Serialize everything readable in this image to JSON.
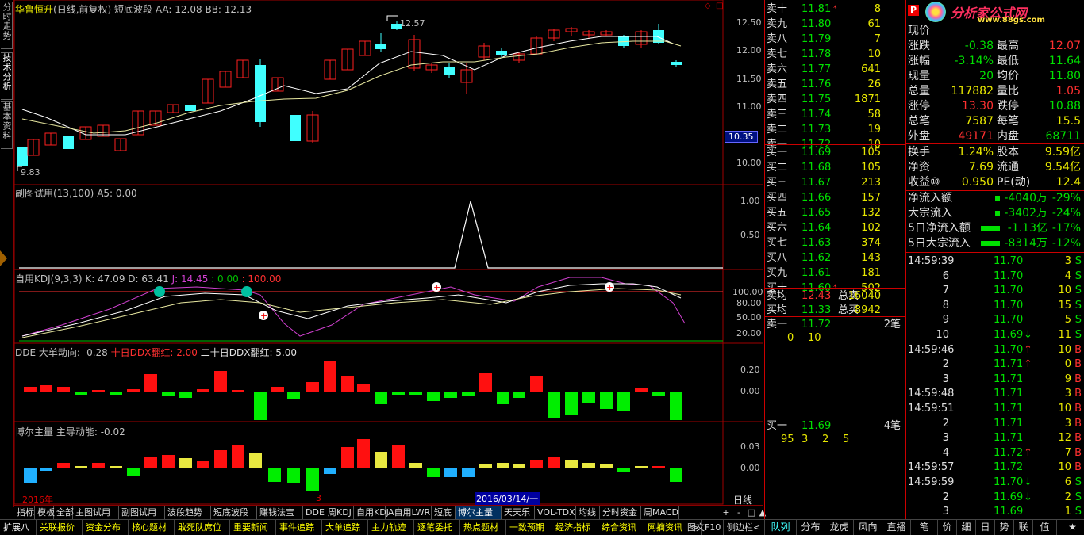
{
  "left_tabs": [
    "分时走势",
    "技术分析",
    "基本资料"
  ],
  "chart": {
    "stock_name": "华鲁恒升",
    "period_info": "(日线,前复权)",
    "indicator_name": "短底波段",
    "aa": "AA: 12.08",
    "bb": "BB: 12.13",
    "high_marker": "12.57",
    "low_marker": "9.83",
    "current_price_tag": "10.35",
    "y_ticks": [
      "12.50",
      "12.00",
      "11.50",
      "11.00",
      "10.50",
      "10.00"
    ],
    "sub1_title": "副图试用(13,100)",
    "sub1_a5": "A5: 0.00",
    "sub1_ticks": [
      "1.00",
      "0.50"
    ],
    "kdj_title": "自用KDJ(9,3,3)",
    "kdj_k": "K: 47.09",
    "kdj_d": "D: 63.41",
    "kdj_j": "J: 14.45",
    "kdj_x1": ": 0.00",
    "kdj_x2": ": 100.00",
    "kdj_ticks": [
      "100.00",
      "80.00",
      "50.00",
      "20.00"
    ],
    "dde_title": "DDE",
    "dde_big": "大单动向: -0.28",
    "dde_ten": "十日DDX翻红: 2.00",
    "dde_twenty": "二十日DDX翻红: 5.00",
    "dde_ticks": [
      "0.20",
      "0.00"
    ],
    "boer_title": "博尔主量",
    "boer_main": "主导动能: -0.02",
    "boer_ticks": [
      "0.03",
      "0.00"
    ],
    "date_year": "2016年",
    "date_month": "3",
    "date_cursor": "2016/03/14/一",
    "period_label": "日线",
    "colors": {
      "up": "#ff2020",
      "down": "#40ffff",
      "ma1": "#ffffff",
      "ma2": "#e8e8a0",
      "kdj_j": "#d040d0"
    }
  },
  "indicator_tabs": [
    "指标",
    "模板",
    "全部",
    "主图试用",
    "副图试用",
    "波段趋势",
    "短底波段",
    "赚钱法宝",
    "DDE",
    "周KDJ",
    "自用KDJ",
    "A自用LWR",
    "短底",
    "博尔主量",
    "天天乐",
    "VOL-TDX",
    "均线",
    "分时资金",
    "周MACD"
  ],
  "tab_controls": [
    "+",
    "-",
    "□",
    "▲"
  ],
  "bottom_tabs": [
    "扩展八",
    "关联报价",
    "资金分布",
    "核心题材",
    "敢死队席位",
    "重要新闻",
    "事件追踪",
    "大单追踪",
    "主力轨迹",
    "逐笔委托",
    "热点题材",
    "一致预期",
    "经济指标",
    "综合资讯",
    "网摘资讯"
  ],
  "bottom_right": [
    "图文F10",
    "侧边栏<"
  ],
  "right_tabs": [
    "队列",
    "分布",
    "龙虎",
    "风向",
    "直播",
    "笔",
    "价",
    "细",
    "日",
    "势",
    "联",
    "值",
    "★"
  ],
  "order_book": {
    "sells": [
      {
        "label": "卖十",
        "price": "11.81",
        "vol": "8",
        "mark": "*"
      },
      {
        "label": "卖九",
        "price": "11.80",
        "vol": "61",
        "mark": ""
      },
      {
        "label": "卖八",
        "price": "11.79",
        "vol": "7",
        "mark": ""
      },
      {
        "label": "卖七",
        "price": "11.78",
        "vol": "10",
        "mark": ""
      },
      {
        "label": "卖六",
        "price": "11.77",
        "vol": "641",
        "mark": ""
      },
      {
        "label": "卖五",
        "price": "11.76",
        "vol": "26",
        "mark": ""
      },
      {
        "label": "卖四",
        "price": "11.75",
        "vol": "1871",
        "mark": ""
      },
      {
        "label": "卖三",
        "price": "11.74",
        "vol": "58",
        "mark": ""
      },
      {
        "label": "卖二",
        "price": "11.73",
        "vol": "19",
        "mark": ""
      },
      {
        "label": "卖一",
        "price": "11.72",
        "vol": "10",
        "mark": ""
      }
    ],
    "buys": [
      {
        "label": "买一",
        "price": "11.69",
        "vol": "105",
        "mark": ""
      },
      {
        "label": "买二",
        "price": "11.68",
        "vol": "105",
        "mark": ""
      },
      {
        "label": "买三",
        "price": "11.67",
        "vol": "213",
        "mark": ""
      },
      {
        "label": "买四",
        "price": "11.66",
        "vol": "157",
        "mark": ""
      },
      {
        "label": "买五",
        "price": "11.65",
        "vol": "132",
        "mark": ""
      },
      {
        "label": "买六",
        "price": "11.64",
        "vol": "102",
        "mark": ""
      },
      {
        "label": "买七",
        "price": "11.63",
        "vol": "374",
        "mark": ""
      },
      {
        "label": "买八",
        "price": "11.62",
        "vol": "143",
        "mark": ""
      },
      {
        "label": "买九",
        "price": "11.61",
        "vol": "181",
        "mark": ""
      },
      {
        "label": "买十",
        "price": "11.60",
        "vol": "502",
        "mark": "*"
      }
    ],
    "avg_sell_label": "卖均",
    "avg_sell": "12.43",
    "total_sell_label": "总卖",
    "total_sell": "16040",
    "avg_buy_label": "买均",
    "avg_buy": "11.33",
    "total_buy_label": "总买",
    "total_buy": "8942",
    "sell1_queue_label": "卖一",
    "sell1_queue_price": "11.72",
    "sell1_queue_count": "2笔",
    "sell1_queue_vals": [
      "0",
      "10"
    ],
    "buy1_queue_label": "买一",
    "buy1_queue_price": "11.69",
    "buy1_queue_count": "4笔",
    "buy1_queue_vals": [
      "95",
      "3",
      "2",
      "5"
    ]
  },
  "quote": {
    "logo_text": "分析家公式网",
    "logo_url": "www.88gs.com",
    "rows": [
      {
        "l1": "现价",
        "v1": "",
        "l2": "",
        "v2": ""
      },
      {
        "l1": "涨跌",
        "v1": "-0.38",
        "l2": "最高",
        "v2": "12.07"
      },
      {
        "l1": "涨幅",
        "v1": "-3.14%",
        "l2": "最低",
        "v2": "11.64"
      },
      {
        "l1": "现量",
        "v1": "20",
        "l2": "均价",
        "v2": "11.80"
      },
      {
        "l1": "总量",
        "v1": "117882",
        "l2": "量比",
        "v2": "1.05"
      },
      {
        "l1": "涨停",
        "v1": "13.30",
        "l2": "跌停",
        "v2": "10.88"
      },
      {
        "l1": "总笔",
        "v1": "7587",
        "l2": "每笔",
        "v2": "15.5"
      },
      {
        "l1": "外盘",
        "v1": "49171",
        "l2": "内盘",
        "v2": "68711"
      },
      {
        "l1": "换手",
        "v1": "1.24%",
        "l2": "股本",
        "v2": "9.59亿"
      },
      {
        "l1": "净资",
        "v1": "7.69",
        "l2": "流通",
        "v2": "9.54亿"
      },
      {
        "l1": "收益⑩",
        "v1": "0.950",
        "l2": "PE(动)",
        "v2": "12.4"
      }
    ],
    "flows": [
      {
        "label": "净流入额",
        "value": "-4040万",
        "pct": "-29%"
      },
      {
        "label": "大宗流入",
        "value": "-3402万",
        "pct": "-24%"
      },
      {
        "label": "5日净流入额",
        "value": "-1.13亿",
        "pct": "-17%"
      },
      {
        "label": "5日大宗流入",
        "value": "-8314万",
        "pct": "-12%"
      }
    ]
  },
  "ticks": [
    {
      "time": "14:59:39",
      "price": "11.70",
      "arrow": "",
      "vol": "3",
      "bs": "S"
    },
    {
      "time": "6",
      "price": "11.70",
      "arrow": "",
      "vol": "4",
      "bs": "S"
    },
    {
      "time": "7",
      "price": "11.70",
      "arrow": "",
      "vol": "10",
      "bs": "S"
    },
    {
      "time": "8",
      "price": "11.70",
      "arrow": "",
      "vol": "15",
      "bs": "S"
    },
    {
      "time": "9",
      "price": "11.70",
      "arrow": "",
      "vol": "5",
      "bs": "S"
    },
    {
      "time": "10",
      "price": "11.69",
      "arrow": "↓",
      "vol": "11",
      "bs": "S"
    },
    {
      "time": "14:59:46",
      "price": "11.70",
      "arrow": "↑",
      "vol": "10",
      "bs": "B"
    },
    {
      "time": "2",
      "price": "11.71",
      "arrow": "↑",
      "vol": "0",
      "bs": "B"
    },
    {
      "time": "3",
      "price": "11.71",
      "arrow": "",
      "vol": "9",
      "bs": "B"
    },
    {
      "time": "14:59:48",
      "price": "11.71",
      "arrow": "",
      "vol": "3",
      "bs": "B"
    },
    {
      "time": "14:59:51",
      "price": "11.71",
      "arrow": "",
      "vol": "10",
      "bs": "B"
    },
    {
      "time": "2",
      "price": "11.71",
      "arrow": "",
      "vol": "3",
      "bs": "B"
    },
    {
      "time": "3",
      "price": "11.71",
      "arrow": "",
      "vol": "12",
      "bs": "B"
    },
    {
      "time": "4",
      "price": "11.72",
      "arrow": "↑",
      "vol": "7",
      "bs": "B"
    },
    {
      "time": "14:59:57",
      "price": "11.72",
      "arrow": "",
      "vol": "10",
      "bs": "B"
    },
    {
      "time": "14:59:59",
      "price": "11.70",
      "arrow": "↓",
      "vol": "6",
      "bs": "S"
    },
    {
      "time": "2",
      "price": "11.69",
      "arrow": "↓",
      "vol": "2",
      "bs": "S"
    },
    {
      "time": "3",
      "price": "11.69",
      "arrow": "",
      "vol": "1",
      "bs": "S"
    }
  ]
}
